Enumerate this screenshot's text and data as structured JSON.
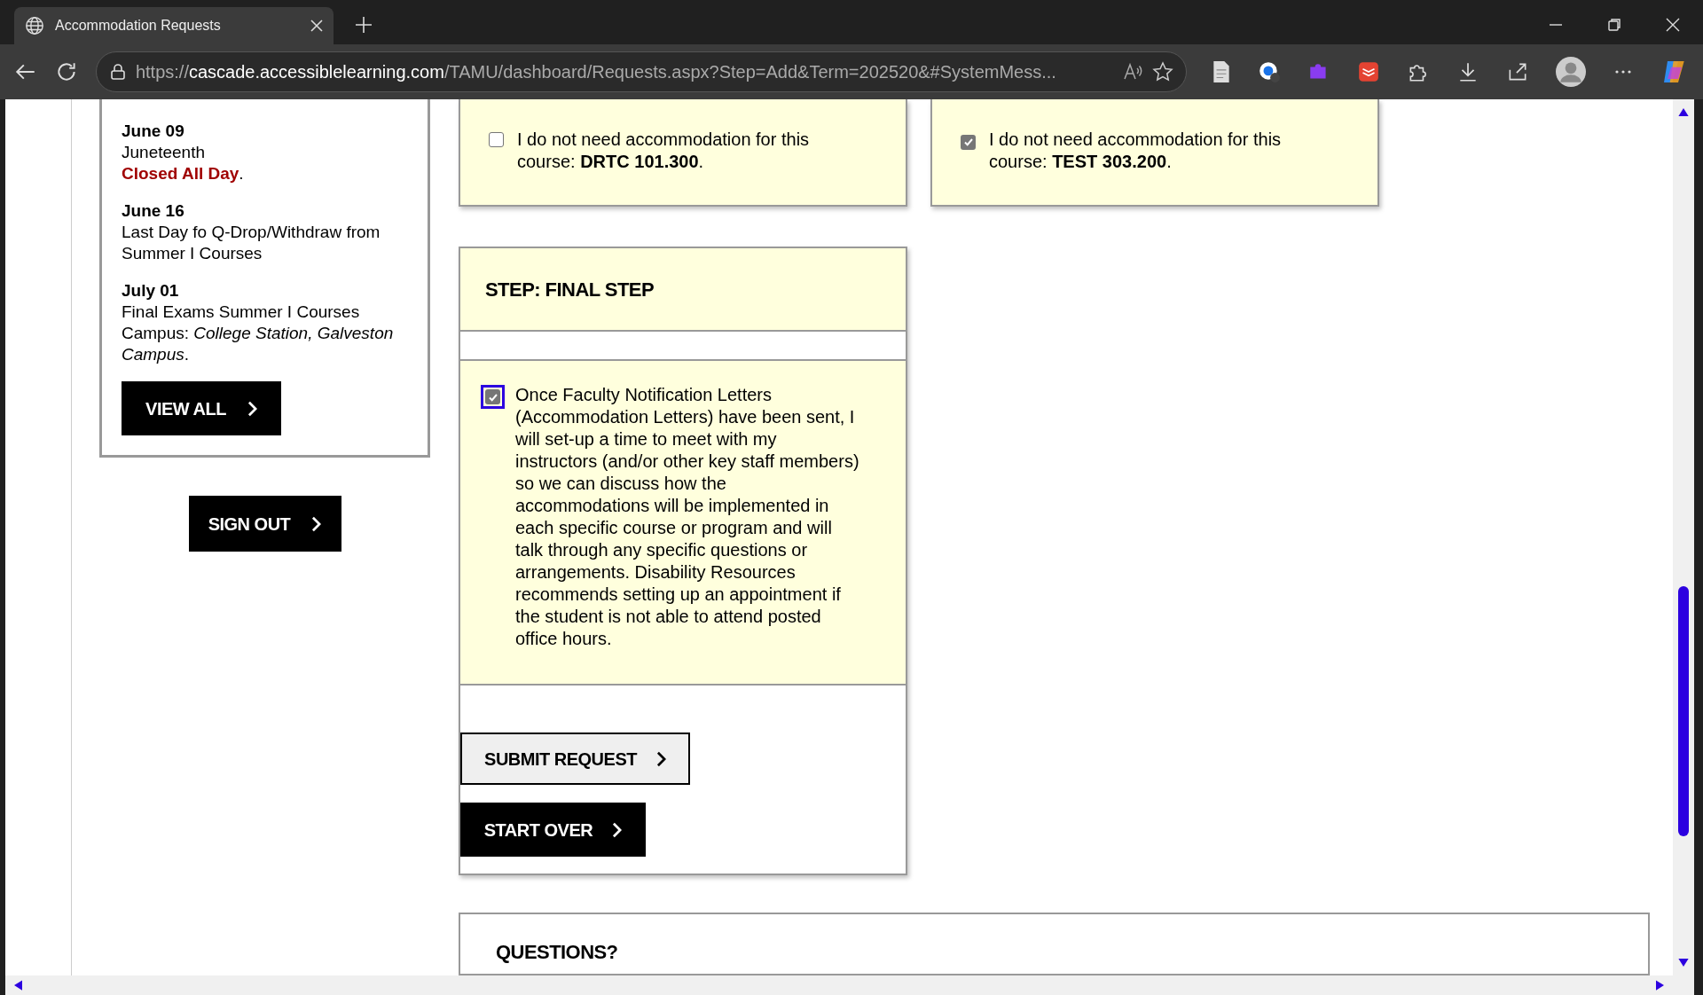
{
  "browser": {
    "tab_title": "Accommodation Requests",
    "url": {
      "scheme": "https://",
      "host": "cascade.accessiblelearning.com",
      "path": "/TAMU/dashboard/Requests.aspx?Step=Add&Term=202520&#SystemMess..."
    }
  },
  "sidebar": {
    "events": [
      {
        "date": "June 09",
        "lines": [
          "Juneteenth",
          "**Closed All Day**."
        ]
      },
      {
        "date": "June 16",
        "lines": [
          "Last Day fo Q-Drop/Withdraw from Summer I Courses"
        ]
      },
      {
        "date": "July 01",
        "lines": [
          "Final Exams Summer I Courses",
          "Campus: *College Station, Galveston Campus*."
        ]
      }
    ],
    "view_all": "VIEW ALL",
    "sign_out": "SIGN OUT"
  },
  "course_optouts": [
    {
      "text": "I do not need accommodation for this course: **DRTC 101.300**.",
      "checked": false
    },
    {
      "text": "I do not need accommodation for this course: **TEST 303.200**.",
      "checked": true
    }
  ],
  "final_step": {
    "title": "STEP: FINAL STEP",
    "agreement": {
      "text": "Once Faculty Notification Letters (Accommodation Letters) have been sent, I will set-up a time to meet with my instructors (and/or other key staff members) so we can discuss how the accommodations will be implemented in each specific course or program and will talk through any specific questions or arrangements. Disability Resources recommends setting up an appointment if the student is not able to attend posted office hours.",
      "checked": true,
      "focused": true
    },
    "buttons": [
      {
        "label": "SUBMIT REQUEST",
        "kind": "outline"
      },
      {
        "label": "START OVER",
        "kind": "solid"
      }
    ]
  },
  "questions": {
    "title": "QUESTIONS?"
  }
}
